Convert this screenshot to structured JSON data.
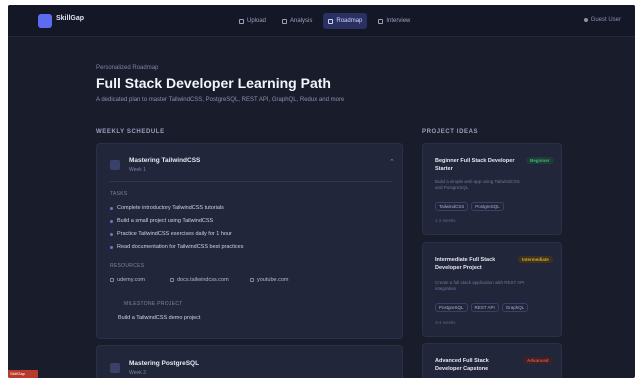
{
  "app": {
    "name": "SkillGap"
  },
  "nav": [
    {
      "label": "Upload",
      "active": false
    },
    {
      "label": "Analysis",
      "active": false
    },
    {
      "label": "Roadmap",
      "active": true
    },
    {
      "label": "Interview",
      "active": false
    }
  ],
  "user": {
    "label": "Guest User"
  },
  "page": {
    "breadcrumb": "Personalized Roadmap",
    "title": "Full Stack Developer Learning Path",
    "subtitle": "A dedicated plan to master TailwindCSS, PostgreSQL, REST API, GraphQL, Redux and more"
  },
  "schedule": {
    "heading": "WEEKLY SCHEDULE",
    "cards": [
      {
        "title": "Mastering TailwindCSS",
        "sub": "Week 1",
        "tasks_label": "TASKS",
        "tasks": [
          "Complete introductory TailwindCSS tutorials",
          "Build a small project using TailwindCSS",
          "Practice TailwindCSS exercises daily for 1 hour",
          "Read documentation for TailwindCSS best practices"
        ],
        "resources_label": "RESOURCES",
        "resources": [
          "udemy.com",
          "docs.tailwindcss.com",
          "youtube.com"
        ],
        "milestone_label": "MILESTONE PROJECT",
        "milestone": "Build a TailwindCSS demo project"
      },
      {
        "title": "Mastering PostgreSQL",
        "sub": "Week 2"
      }
    ]
  },
  "projects": {
    "heading": "PROJECT IDEAS",
    "items": [
      {
        "title": "Beginner Full Stack Developer Starter",
        "level": "Beginner",
        "level_color": "#3fb37f",
        "desc": "Build a simple web app using TailwindCSS and PostgreSQL",
        "chips": [
          "TailwindCSS",
          "PostgreSQL"
        ],
        "meta": "1-2 weeks"
      },
      {
        "title": "Intermediate Full Stack Developer Project",
        "level": "Intermediate",
        "level_color": "#d9a43a",
        "desc": "Create a full stack application with REST API integration",
        "chips": [
          "PostgreSQL",
          "REST API",
          "GraphQL"
        ],
        "meta": "3-4 weeks"
      },
      {
        "title": "Advanced Full Stack Developer Capstone",
        "level": "Advanced",
        "level_color": "#d9534f"
      }
    ]
  },
  "corner_label": "SkillGap"
}
